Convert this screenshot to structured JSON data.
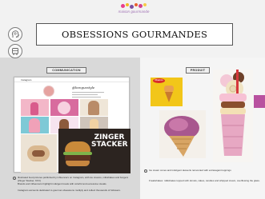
{
  "slide": {
    "logo_text": "maison gourmande",
    "title": "OBSESSIONS GOURMANDES",
    "icons": [
      "head-profile-icon",
      "bus-icon"
    ]
  },
  "left_section": {
    "tag": "COMMUNICATION",
    "instagram": {
      "app_name": "Instagram",
      "handle": "@bongusstyle",
      "ad_text": "ZINGER STACKER"
    },
    "captions": [
      "Illustrated food pictures published by influencers on Instagram, with ice creams, milkshakes and burgers (Zinger Stacker, KFC)",
      "Brands and influencers highlight indulgent treats with colorful and excessive visuals.",
      "Instagram accounts dedicated to gourmet obsessions multiply and collect thousands of followers."
    ]
  },
  "right_section": {
    "tag": "PRODUIT",
    "churros_label": "Churros",
    "captions": [
      "Ice cream cones and indulgent desserts reinvented with extravagant toppings",
      "Freakshakes: milkshakes topped with donuts, cakes, candies and whipped cream, overflowing the glass."
    ]
  },
  "colors": {
    "panel_left": "#d9d9d9",
    "panel_right": "#f5f5f5",
    "accent_purple": "#b8519f",
    "title_border": "#555555"
  }
}
